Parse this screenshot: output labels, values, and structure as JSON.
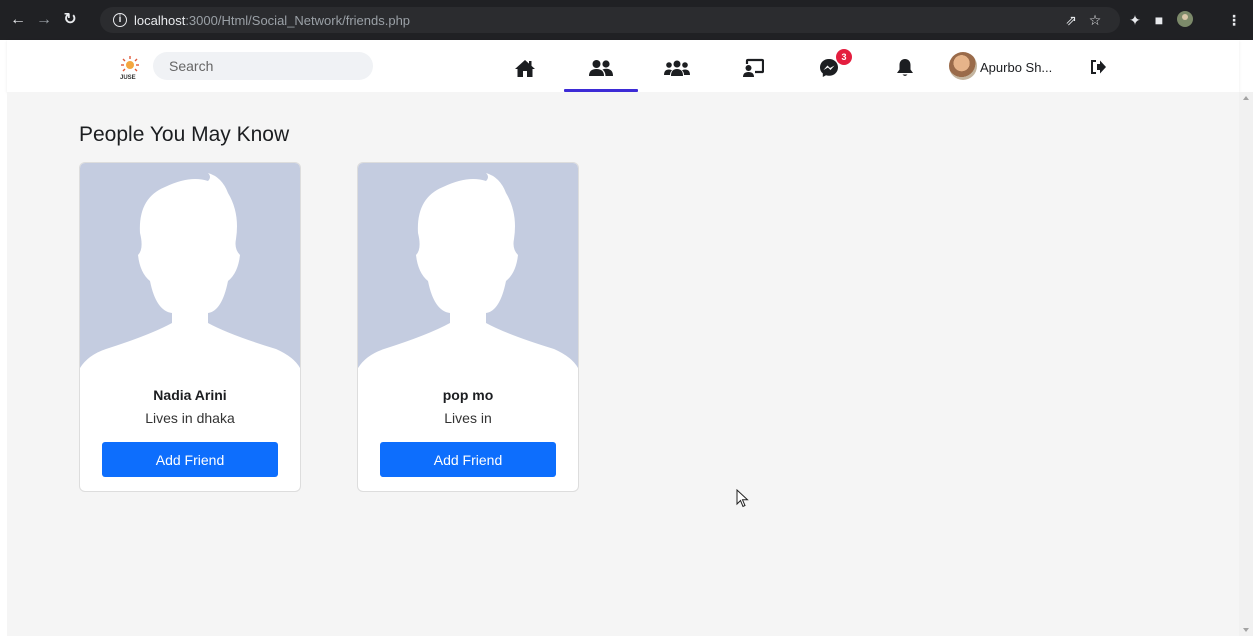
{
  "browser": {
    "url_host": "localhost",
    "url_path": ":3000/Html/Social_Network/friends.php",
    "nav_icons": [
      "back-arrow-icon",
      "forward-arrow-icon",
      "reload-icon"
    ],
    "right_icons": [
      "share-icon",
      "star-icon",
      "extensions-icon",
      "sidebar-icon",
      "profile-icon",
      "menu-icon"
    ]
  },
  "header": {
    "logo_text": "JUSE",
    "search_placeholder": "Search",
    "nav_items": [
      {
        "icon": "home-icon",
        "active": false
      },
      {
        "icon": "friends-icon",
        "active": true
      },
      {
        "icon": "groups-icon",
        "active": false
      },
      {
        "icon": "watch-icon",
        "active": false
      },
      {
        "icon": "messenger-icon",
        "active": false,
        "badge": "3"
      },
      {
        "icon": "bell-icon",
        "active": false
      }
    ],
    "user_name": "Apurbo Sh...",
    "accent_color": "#3d2bd6"
  },
  "main": {
    "section_title": "People You May Know",
    "people": [
      {
        "name": "Nadia Arini",
        "location": "Lives in dhaka",
        "button": "Add Friend"
      },
      {
        "name": "pop mo",
        "location": "Lives in",
        "button": "Add Friend"
      }
    ],
    "button_color": "#0d6efd"
  }
}
